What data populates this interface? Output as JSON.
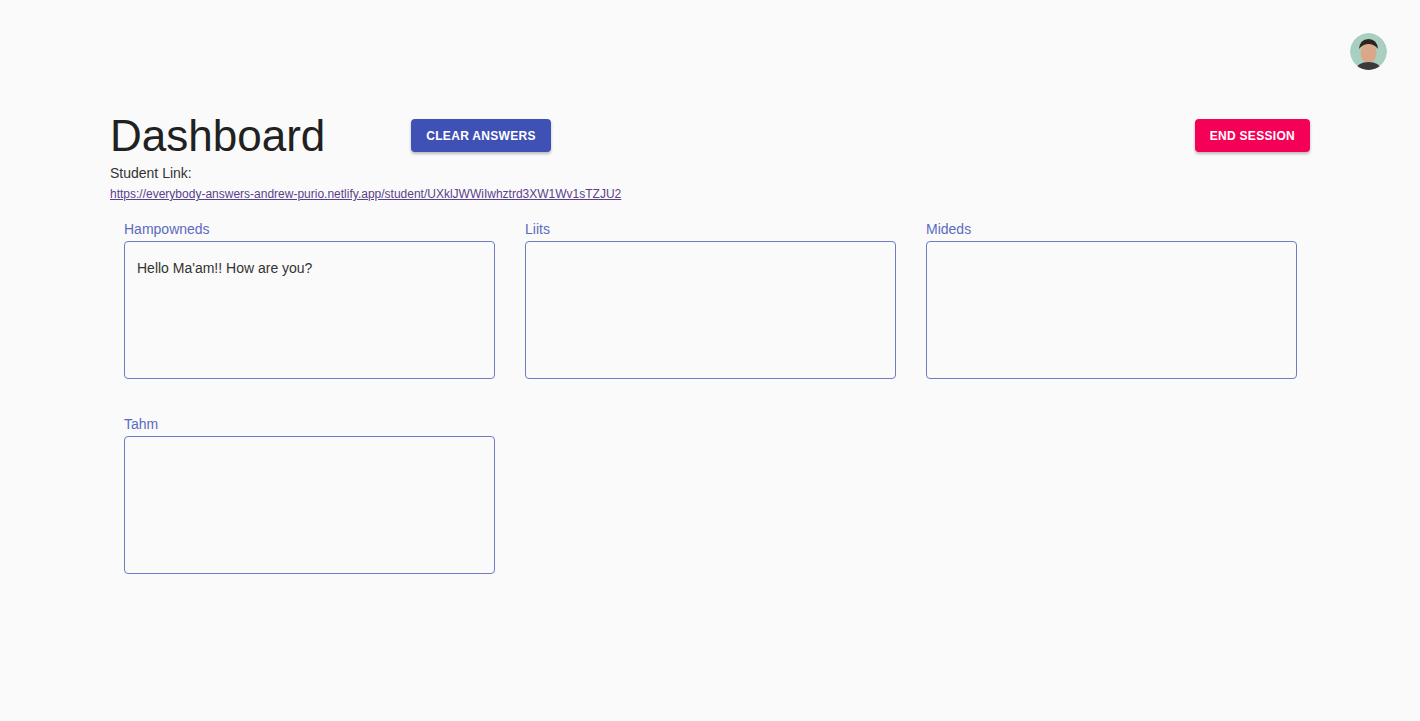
{
  "header": {
    "title": "Dashboard",
    "clear_button": "CLEAR ANSWERS",
    "end_button": "END SESSION"
  },
  "student_link": {
    "label": "Student Link:",
    "url": "https://everybody-answers-andrew-purio.netlify.app/student/UXklJWWiIwhztrd3XW1Wv1sTZJU2"
  },
  "students": [
    {
      "name": "Hampowneds",
      "answer": "Hello Ma'am!! How are you?"
    },
    {
      "name": "Liits",
      "answer": ""
    },
    {
      "name": "Mideds",
      "answer": ""
    },
    {
      "name": "Tahm",
      "answer": ""
    }
  ]
}
